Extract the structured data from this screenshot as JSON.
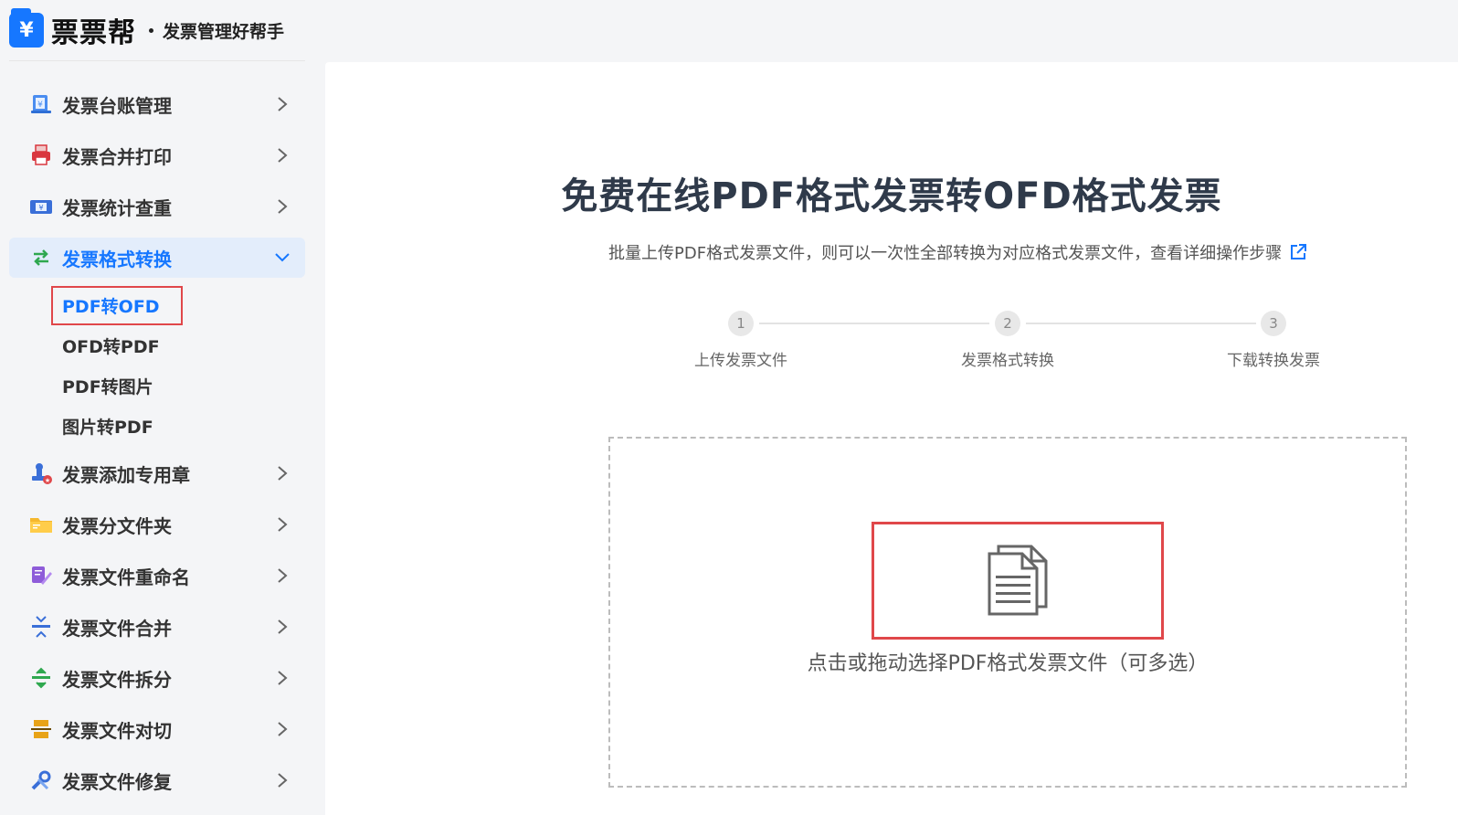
{
  "header": {
    "logo_glyph": "¥",
    "brand": "票票帮",
    "slogan": "发票管理好帮手"
  },
  "sidebar": {
    "items": [
      {
        "label": "发票台账管理",
        "icon": "ledger-icon"
      },
      {
        "label": "发票合并打印",
        "icon": "printer-icon"
      },
      {
        "label": "发票统计查重",
        "icon": "money-icon"
      },
      {
        "label": "发票格式转换",
        "icon": "convert-icon",
        "active": true
      },
      {
        "label": "发票添加专用章",
        "icon": "stamp-icon"
      },
      {
        "label": "发票分文件夹",
        "icon": "folder-icon"
      },
      {
        "label": "发票文件重命名",
        "icon": "rename-icon"
      },
      {
        "label": "发票文件合并",
        "icon": "merge-icon"
      },
      {
        "label": "发票文件拆分",
        "icon": "split-icon"
      },
      {
        "label": "发票文件对切",
        "icon": "cut-icon"
      },
      {
        "label": "发票文件修复",
        "icon": "wrench-icon"
      }
    ],
    "submenu": [
      {
        "label": "PDF转OFD",
        "active": true
      },
      {
        "label": "OFD转PDF"
      },
      {
        "label": "PDF转图片"
      },
      {
        "label": "图片转PDF"
      }
    ]
  },
  "main": {
    "title": "免费在线PDF格式发票转OFD格式发票",
    "description": "批量上传PDF格式发票文件，则可以一次性全部转换为对应格式发票文件，查看详细操作步骤",
    "steps": [
      {
        "number": "1",
        "label": "上传发票文件"
      },
      {
        "number": "2",
        "label": "发票格式转换"
      },
      {
        "number": "3",
        "label": "下载转换发票"
      }
    ],
    "dropzone_text": "点击或拖动选择PDF格式发票文件（可多选）"
  },
  "colors": {
    "accent": "#1677ff",
    "highlight_border": "#e0474a",
    "active_bg": "#e3edfb"
  }
}
